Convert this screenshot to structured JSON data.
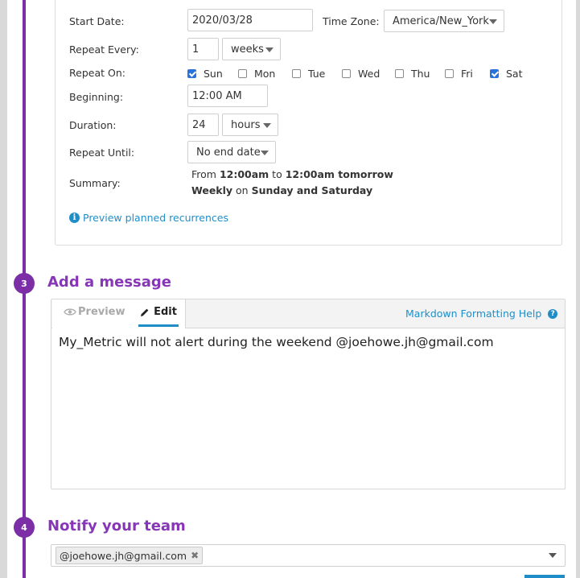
{
  "schedule": {
    "start_date_label": "Start Date:",
    "start_date_value": "2020/03/28",
    "time_zone_label": "Time Zone:",
    "time_zone_value": "America/New_York",
    "repeat_every_label": "Repeat Every:",
    "repeat_every_value": "1",
    "repeat_every_unit": "weeks",
    "repeat_on_label": "Repeat On:",
    "days": [
      {
        "label": "Sun",
        "checked": true
      },
      {
        "label": "Mon",
        "checked": false
      },
      {
        "label": "Tue",
        "checked": false
      },
      {
        "label": "Wed",
        "checked": false
      },
      {
        "label": "Thu",
        "checked": false
      },
      {
        "label": "Fri",
        "checked": false
      },
      {
        "label": "Sat",
        "checked": true
      }
    ],
    "beginning_label": "Beginning:",
    "beginning_value": "12:00 AM",
    "duration_label": "Duration:",
    "duration_value": "24",
    "duration_unit": "hours",
    "repeat_until_label": "Repeat Until:",
    "repeat_until_value": "No end date",
    "summary_label": "Summary:",
    "summary_line1": {
      "prefix": "From ",
      "start": "12:00am",
      "mid": " to ",
      "end": "12:00am tomorrow"
    },
    "summary_line2": {
      "freq": "Weekly",
      "mid": " on ",
      "days": "Sunday and Saturday"
    },
    "preview_link": "Preview planned recurrences"
  },
  "step3": {
    "number": "3",
    "title": "Add a message"
  },
  "message": {
    "tab_preview": "Preview",
    "tab_edit": "Edit",
    "markdown_help": "Markdown Formatting Help",
    "text": "My_Metric will not alert during the weekend @joehowe.jh@gmail.com"
  },
  "step4": {
    "number": "4",
    "title": "Notify your team"
  },
  "notify": {
    "tag": "@joehowe.jh@gmail.com"
  },
  "colors": {
    "accent_purple": "#7b2ea6",
    "link_blue": "#1f8ec8",
    "checkbox_blue": "#2a73d9"
  }
}
